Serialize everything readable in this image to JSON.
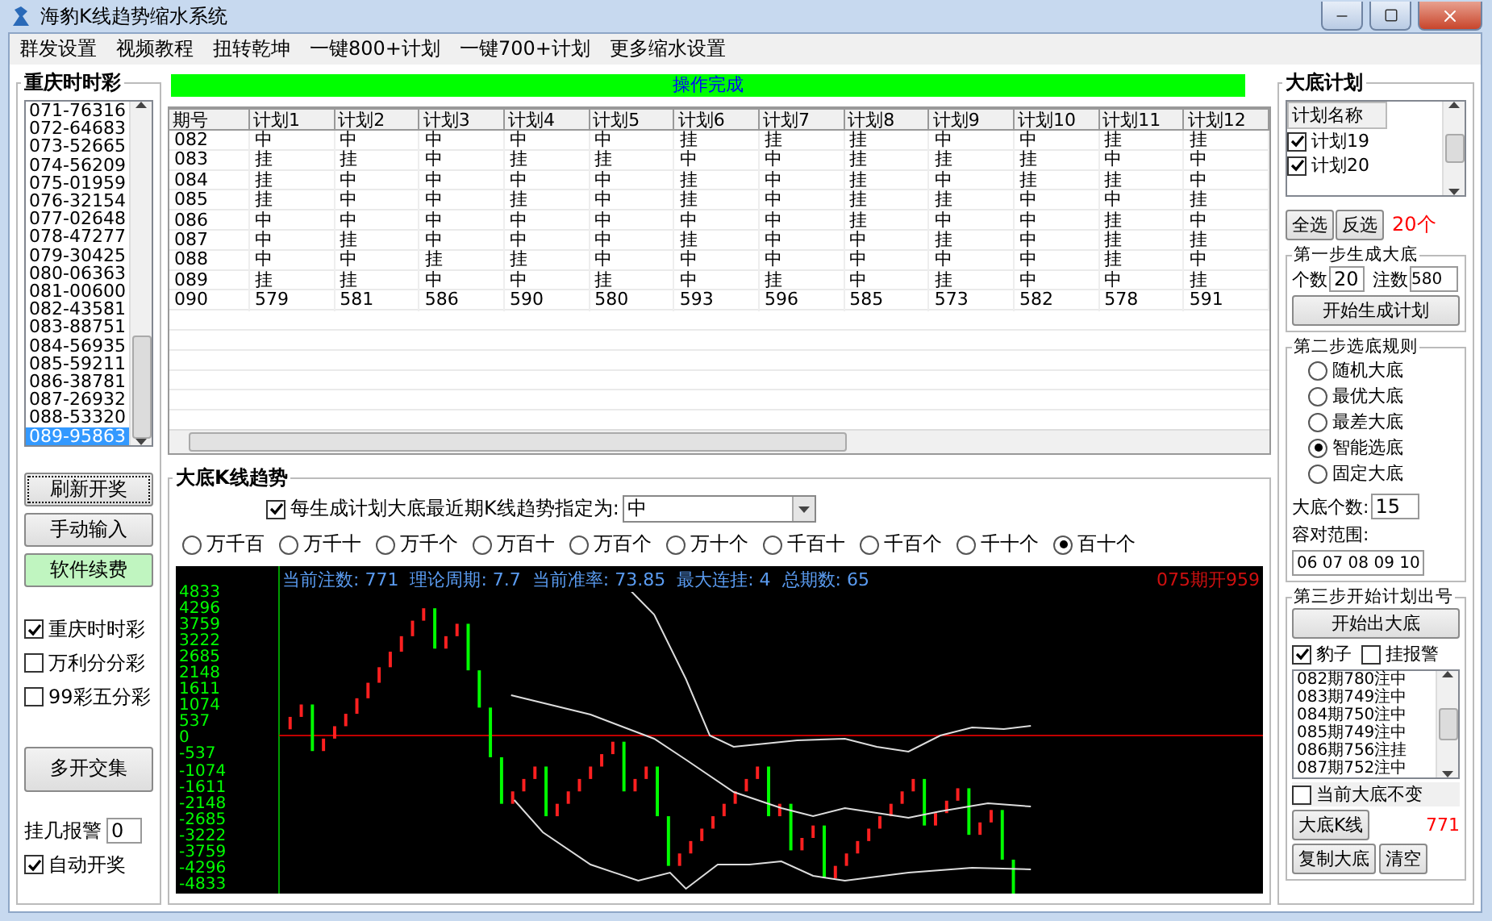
{
  "window": {
    "title": "海豹K线趋势缩水系统"
  },
  "menu": [
    "群发设置",
    "视频教程",
    "扭转乾坤",
    "一键800+计划",
    "一键700+计划",
    "更多缩水设置"
  ],
  "lottery_panel": {
    "title": "重庆时时彩",
    "draws": [
      {
        "text": "071-76316",
        "selected": false
      },
      {
        "text": "072-64683",
        "selected": false
      },
      {
        "text": "073-52665",
        "selected": false
      },
      {
        "text": "074-56209",
        "selected": false
      },
      {
        "text": "075-01959",
        "selected": false
      },
      {
        "text": "076-32154",
        "selected": false
      },
      {
        "text": "077-02648",
        "selected": false
      },
      {
        "text": "078-47277",
        "selected": false
      },
      {
        "text": "079-30425",
        "selected": false
      },
      {
        "text": "080-06363",
        "selected": false
      },
      {
        "text": "081-00600",
        "selected": false
      },
      {
        "text": "082-43581",
        "selected": false
      },
      {
        "text": "083-88751",
        "selected": false
      },
      {
        "text": "084-56935",
        "selected": false
      },
      {
        "text": "085-59211",
        "selected": false
      },
      {
        "text": "086-38781",
        "selected": false
      },
      {
        "text": "087-26932",
        "selected": false
      },
      {
        "text": "088-53320",
        "selected": false
      },
      {
        "text": "089-95863",
        "selected": true
      }
    ],
    "buttons": [
      {
        "label": "刷新开奖",
        "kind": "focused"
      },
      {
        "label": "手动输入",
        "kind": "normal"
      },
      {
        "label": "软件续费",
        "kind": "green"
      }
    ],
    "lotteries": [
      {
        "label": "重庆时时彩",
        "checked": true
      },
      {
        "label": "万利分分彩",
        "checked": false
      },
      {
        "label": "99彩五分彩",
        "checked": false
      }
    ],
    "intersect_button": "多开交集",
    "alarm_label": "挂几报警",
    "alarm_value": "0",
    "auto_draw": {
      "label": "自动开奖",
      "checked": true
    }
  },
  "status": "操作完成",
  "table": {
    "columns": [
      "期号",
      "计划1",
      "计划2",
      "计划3",
      "计划4",
      "计划5",
      "计划6",
      "计划7",
      "计划8",
      "计划9",
      "计划10",
      "计划11",
      "计划12"
    ],
    "rows": [
      [
        "082",
        "中",
        "中",
        "中",
        "中",
        "中",
        "挂",
        "挂",
        "挂",
        "中",
        "中",
        "挂",
        "挂"
      ],
      [
        "083",
        "挂",
        "挂",
        "中",
        "挂",
        "挂",
        "中",
        "中",
        "挂",
        "挂",
        "挂",
        "中",
        "中"
      ],
      [
        "084",
        "挂",
        "中",
        "中",
        "中",
        "中",
        "挂",
        "中",
        "挂",
        "中",
        "挂",
        "挂",
        "中"
      ],
      [
        "085",
        "挂",
        "中",
        "中",
        "挂",
        "中",
        "挂",
        "中",
        "挂",
        "挂",
        "中",
        "中",
        "挂"
      ],
      [
        "086",
        "中",
        "中",
        "中",
        "中",
        "中",
        "中",
        "中",
        "挂",
        "中",
        "中",
        "挂",
        "中"
      ],
      [
        "087",
        "中",
        "挂",
        "中",
        "中",
        "中",
        "挂",
        "中",
        "中",
        "挂",
        "中",
        "挂",
        "挂"
      ],
      [
        "088",
        "中",
        "中",
        "挂",
        "挂",
        "中",
        "中",
        "中",
        "中",
        "中",
        "中",
        "挂",
        "中"
      ],
      [
        "089",
        "挂",
        "挂",
        "中",
        "中",
        "挂",
        "中",
        "挂",
        "中",
        "挂",
        "中",
        "中",
        "挂"
      ],
      [
        "090",
        "579",
        "581",
        "586",
        "590",
        "580",
        "593",
        "596",
        "585",
        "573",
        "582",
        "578",
        "591"
      ]
    ]
  },
  "trend": {
    "title": "大底K线趋势",
    "assign": {
      "label": "每生成计划大底最近期K线趋势指定为:",
      "checked": true,
      "value": "中"
    },
    "positions": [
      {
        "label": "万千百",
        "selected": false
      },
      {
        "label": "万千十",
        "selected": false
      },
      {
        "label": "万千个",
        "selected": false
      },
      {
        "label": "万百十",
        "selected": false
      },
      {
        "label": "万百个",
        "selected": false
      },
      {
        "label": "万十个",
        "selected": false
      },
      {
        "label": "千百十",
        "selected": false
      },
      {
        "label": "千百个",
        "selected": false
      },
      {
        "label": "千十个",
        "selected": false
      },
      {
        "label": "百十个",
        "selected": true
      }
    ],
    "chart": {
      "stats": "当前注数: 771  理论周期: 7.7  当前准率: 73.85  最大连挂: 4  总期数: 65",
      "last_draw": "075期开959",
      "y_labels": [
        "4833",
        "4296",
        "3759",
        "3222",
        "2685",
        "2148",
        "1611",
        "1074",
        "537",
        "0",
        "-537",
        "-1074",
        "-1611",
        "-2148",
        "-2685",
        "-3222",
        "-3759",
        "-4296",
        "-4833"
      ]
    }
  },
  "plan_panel": {
    "title": "大底计划",
    "list_header": "计划名称",
    "plans": [
      {
        "label": "计划19",
        "checked": true
      },
      {
        "label": "计划20",
        "checked": true
      }
    ],
    "select_all": "全选",
    "invert": "反选",
    "count": "20个",
    "step1": {
      "title": "第一步生成大底",
      "count_label": "个数",
      "count_value": "20",
      "bets_label": "注数",
      "bets_value": "580",
      "button": "开始生成计划"
    },
    "step2": {
      "title": "第二步选底规则",
      "rules": [
        {
          "label": "随机大底",
          "selected": false
        },
        {
          "label": "最优大底",
          "selected": false
        },
        {
          "label": "最差大底",
          "selected": false
        },
        {
          "label": "智能选底",
          "selected": true
        },
        {
          "label": "固定大底",
          "selected": false
        }
      ],
      "size_label": "大底个数:",
      "size_value": "15",
      "range_label": "容对范围:",
      "range_value": "06 07 08 09 10"
    },
    "step3": {
      "title": "第三步开始计划出号",
      "button": "开始出大底",
      "options": [
        {
          "label": "豹子",
          "checked": true
        },
        {
          "label": "挂报警",
          "checked": false
        }
      ],
      "results": [
        "082期780注中",
        "083期749注中",
        "084期750注中",
        "085期749注中",
        "086期756注挂",
        "087期752注中"
      ],
      "keep": {
        "label": "当前大底不变",
        "checked": false
      },
      "kline_button": "大底K线",
      "bets": "771",
      "copy_button": "复制大底",
      "clear_button": "清空"
    }
  }
}
